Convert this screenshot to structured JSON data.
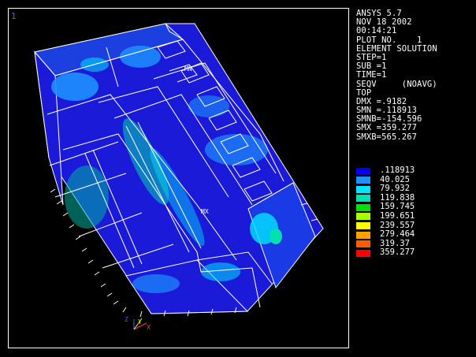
{
  "window_number": "1",
  "header": {
    "program": "ANSYS 5.7",
    "date": "NOV 18 2002",
    "time": "00:14:21",
    "plot_no": "PLOT NO.    1",
    "title": "ELEMENT SOLUTION"
  },
  "solution_info": [
    "STEP=1",
    "SUB =1",
    "TIME=1",
    "SEQV     (NOAVG)",
    "TOP",
    "DMX =.9182",
    "SMN =.118913",
    "SMNB=-154.596",
    "SMX =359.277",
    "SMXB=565.267"
  ],
  "legend": [
    {
      "value": ".118913",
      "color": "#0000ff"
    },
    {
      "value": "40.025",
      "color": "#1e90ff"
    },
    {
      "value": "79.932",
      "color": "#00e5ff"
    },
    {
      "value": "119.838",
      "color": "#00e0b0"
    },
    {
      "value": "159.745",
      "color": "#00e000"
    },
    {
      "value": "199.651",
      "color": "#a8ff00"
    },
    {
      "value": "239.557",
      "color": "#ffff00"
    },
    {
      "value": "279.464",
      "color": "#ffa000"
    },
    {
      "value": "319.37",
      "color": "#ff5a00"
    },
    {
      "value": "359.277",
      "color": "#ff0000"
    }
  ],
  "markers": {
    "min": "MN",
    "max": "MX"
  },
  "axes": {
    "z": "Z",
    "y": "Y",
    "x": "X"
  },
  "colors": {
    "background": "#000000",
    "model_base": "#1a1ad8",
    "edges": "#ffffff",
    "window_number": "#2a6cff"
  }
}
